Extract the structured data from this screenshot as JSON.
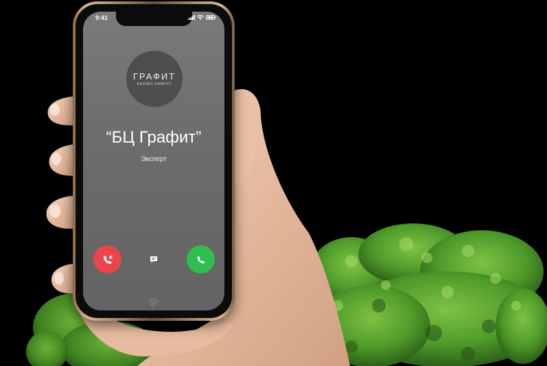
{
  "status_bar": {
    "time": "9:41"
  },
  "caller": {
    "logo_word": "ГРАФИТ",
    "logo_sub": "БИЗНЕС-КАМПУС",
    "name": "“БЦ Графит”",
    "subtitle": "Эксперт"
  },
  "actions": {
    "decline_icon": "phone-decline-icon",
    "message_icon": "message-icon",
    "accept_icon": "phone-accept-icon"
  },
  "colors": {
    "decline": "#e8464b",
    "accept": "#2fbe4f",
    "screen": "#6c6c6c",
    "frame": "#c9a87c"
  }
}
